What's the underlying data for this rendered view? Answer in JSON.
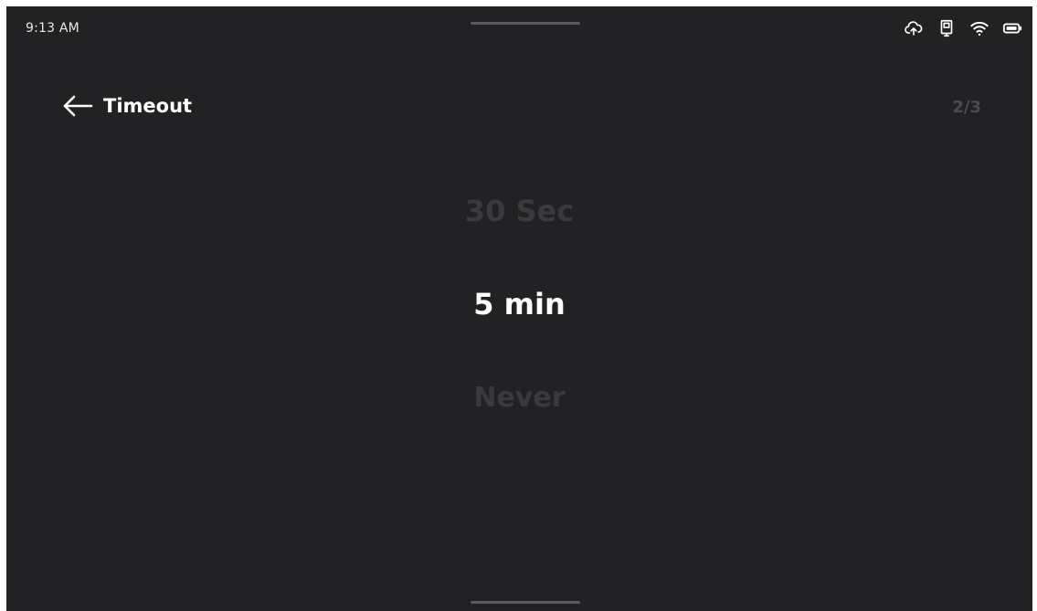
{
  "status_bar": {
    "time": "9:13 AM",
    "icons": [
      "cloud-upload-icon",
      "device-icon",
      "wifi-icon",
      "battery-icon"
    ]
  },
  "header": {
    "title": "Timeout",
    "back_icon": "arrow-left-icon",
    "page_indicator": "2/3"
  },
  "picker": {
    "options": [
      "30 Sec",
      "5 min",
      "Never"
    ],
    "selected": "5 min"
  },
  "colors": {
    "background": "#222224",
    "text_primary": "#ffffff",
    "text_dimmed": "#3a3a3c"
  }
}
